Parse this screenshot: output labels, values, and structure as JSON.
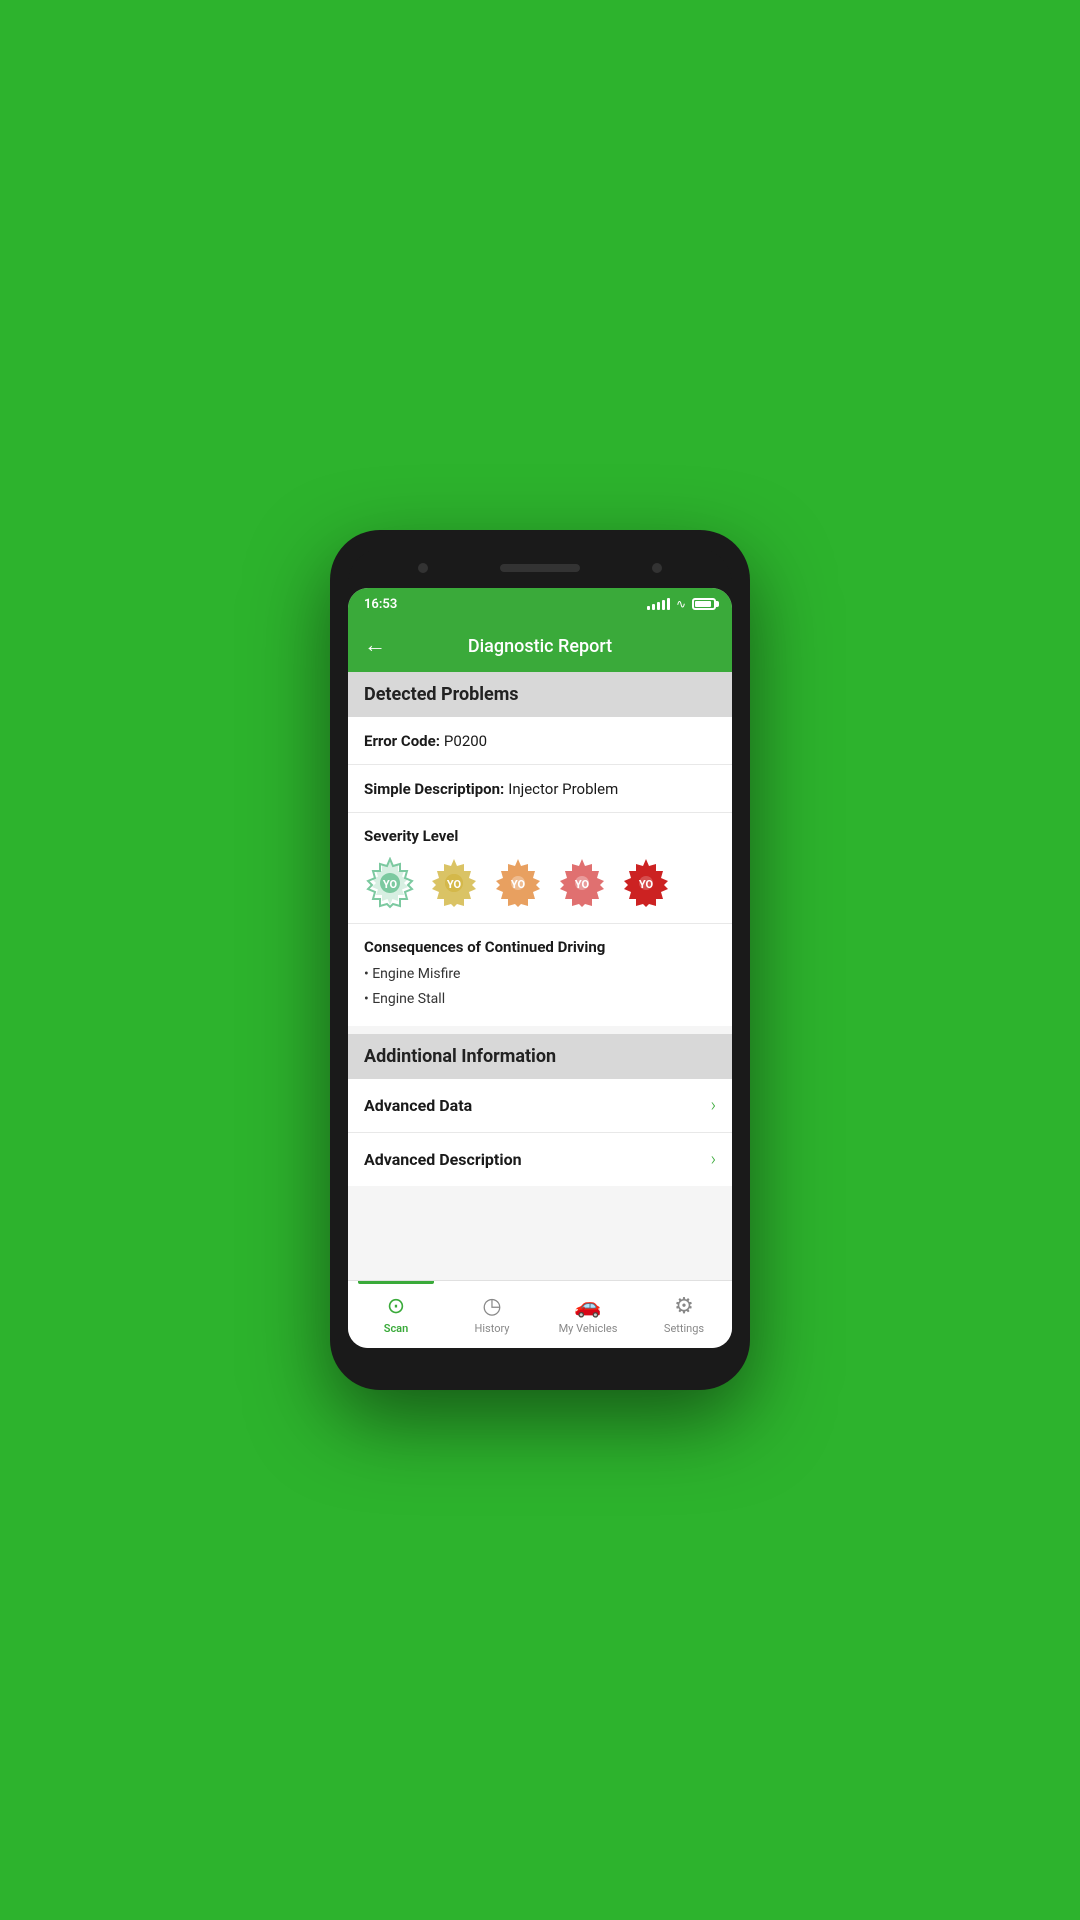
{
  "status": {
    "time": "16:53"
  },
  "header": {
    "title": "Diagnostic Report",
    "back_label": "←"
  },
  "detected_problems": {
    "section_title": "Detected Problems",
    "error_code_label": "Error Code:",
    "error_code_value": "P0200",
    "simple_desc_label": "Simple Descriptipon:",
    "simple_desc_value": "Injector Problem",
    "severity_label": "Severity Level",
    "severity_levels": [
      {
        "color": "#7cc9a0",
        "active": false
      },
      {
        "color": "#d4b84a",
        "active": false
      },
      {
        "color": "#e8a060",
        "active": false
      },
      {
        "color": "#e07070",
        "active": false
      },
      {
        "color": "#cc2222",
        "active": true
      }
    ],
    "consequences_title": "Consequences of Continued Driving",
    "consequences": [
      "Engine Misfire",
      "Engine Stall"
    ]
  },
  "additional_info": {
    "section_title": "Addintional Information",
    "items": [
      {
        "label": "Advanced Data"
      },
      {
        "label": "Advanced Description"
      }
    ]
  },
  "nav": {
    "items": [
      {
        "label": "Scan",
        "active": true
      },
      {
        "label": "History",
        "active": false
      },
      {
        "label": "My Vehicles",
        "active": false
      },
      {
        "label": "Settings",
        "active": false
      }
    ]
  }
}
